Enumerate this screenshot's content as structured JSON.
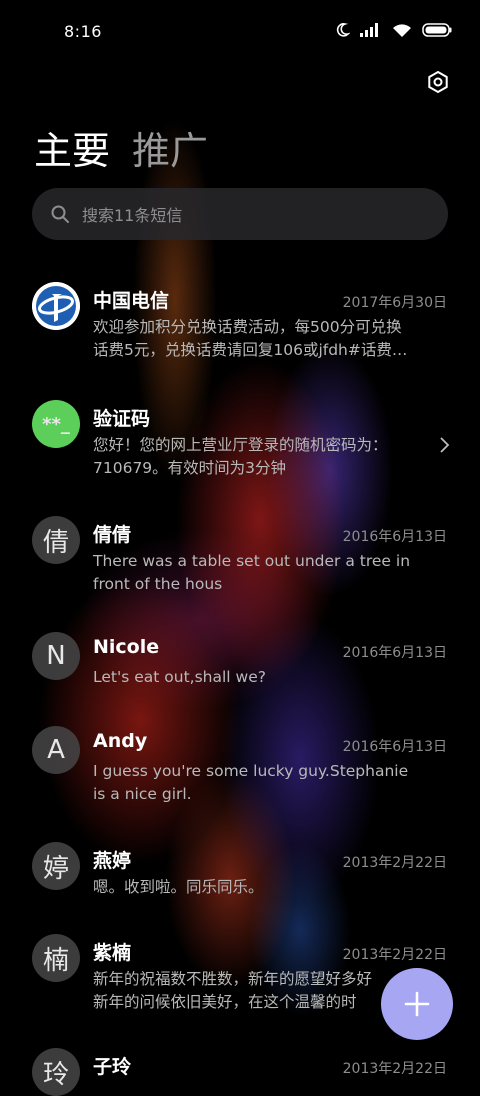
{
  "status_bar": {
    "time": "8:16",
    "icons": [
      "moon-icon",
      "signal-icon",
      "wifi-icon",
      "battery-icon"
    ]
  },
  "header": {
    "settings_icon": "settings-icon",
    "tabs": [
      {
        "label": "主要",
        "active": true
      },
      {
        "label": "推广",
        "active": false
      }
    ]
  },
  "search": {
    "placeholder": "搜索11条短信"
  },
  "conversations": [
    {
      "name": "中国电信",
      "date": "2017年6月30日",
      "preview": "欢迎参加积分兑换话费活动，每500分可兑换\n话费5元，兑换话费请回复106或jfdh#话费…",
      "avatar": "china-telecom-logo"
    },
    {
      "name": "验证码",
      "date": "",
      "preview": "您好！您的网上营业厅登录的随机密码为：\n710679。有效时间为3分钟",
      "avatar": "**_",
      "avatar_color": "#5ccf5a"
    },
    {
      "name": "倩倩",
      "date": "2016年6月13日",
      "preview": "There was a table set out under a tree in\nfront of the hous",
      "avatar": "倩"
    },
    {
      "name": "Nicole",
      "date": "2016年6月13日",
      "preview": "Let's eat out,shall we?",
      "avatar": "N"
    },
    {
      "name": "Andy",
      "date": "2016年6月13日",
      "preview": "I guess you're some lucky guy.Stephanie\nis a nice girl.",
      "avatar": "A"
    },
    {
      "name": "燕婷",
      "date": "2013年2月22日",
      "preview": "嗯。收到啦。同乐同乐。",
      "avatar": "婷"
    },
    {
      "name": "紫楠",
      "date": "2013年2月22日",
      "preview": "新年的祝福数不胜数，新年的愿望好多好\n新年的问候依旧美好，在这个温馨的时",
      "avatar": "楠"
    },
    {
      "name": "子玲",
      "date": "2013年2月22日",
      "preview": "",
      "avatar": "玲"
    }
  ],
  "fab": {
    "icon": "plus-icon"
  },
  "colors": {
    "fab": "#a6a6f2",
    "verify_avatar": "#5ccf5a",
    "telecom_blue": "#1e5fb4"
  }
}
